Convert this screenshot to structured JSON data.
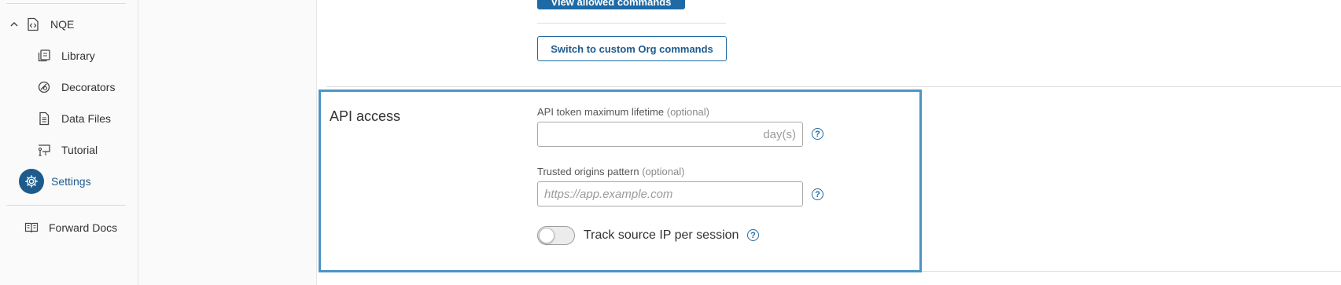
{
  "sidebar": {
    "section": {
      "label": "NQE",
      "expanded": true
    },
    "items": [
      {
        "label": "Library",
        "icon": "library-icon"
      },
      {
        "label": "Decorators",
        "icon": "decorators-icon"
      },
      {
        "label": "Data Files",
        "icon": "data-files-icon"
      },
      {
        "label": "Tutorial",
        "icon": "tutorial-icon"
      }
    ],
    "settings": {
      "label": "Settings",
      "active": true
    },
    "forward_docs": {
      "label": "Forward Docs"
    }
  },
  "main": {
    "view_commands_button": "View allowed commands",
    "switch_button": "Switch to custom Org commands",
    "api_access": {
      "title": "API access",
      "token_lifetime": {
        "label": "API token maximum lifetime",
        "optional": "(optional)",
        "value": "",
        "suffix": "day(s)"
      },
      "trusted_origins": {
        "label": "Trusted origins pattern",
        "optional": "(optional)",
        "value": "",
        "placeholder": "https://app.example.com"
      },
      "track_ip": {
        "label": "Track source IP per session",
        "enabled": false
      },
      "help_glyph": "?"
    }
  },
  "colors": {
    "accent": "#1f6aa5",
    "active_nav": "#1f5a8c",
    "highlight_border": "#4a95c7"
  }
}
